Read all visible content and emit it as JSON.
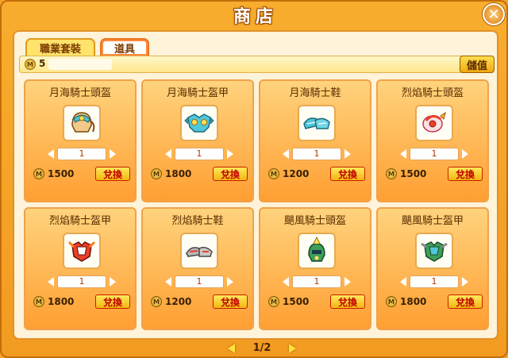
{
  "window": {
    "title": "商店"
  },
  "tabs": [
    {
      "label": "職業套裝"
    },
    {
      "label": "道具"
    }
  ],
  "currency": {
    "amount": "5",
    "deposit_label": "儲值"
  },
  "items": [
    {
      "name": "月海騎士頭盔",
      "qty": "1",
      "price": "1500",
      "buy_label": "兌換",
      "icon": "helmet-icon"
    },
    {
      "name": "月海騎士盔甲",
      "qty": "1",
      "price": "1800",
      "buy_label": "兌換",
      "icon": "armor-icon"
    },
    {
      "name": "月海騎士鞋",
      "qty": "1",
      "price": "1200",
      "buy_label": "兌換",
      "icon": "boots-icon"
    },
    {
      "name": "烈焰騎士頭盔",
      "qty": "1",
      "price": "1500",
      "buy_label": "兌換",
      "icon": "helmet-icon"
    },
    {
      "name": "烈焰騎士盔甲",
      "qty": "1",
      "price": "1800",
      "buy_label": "兌換",
      "icon": "armor-icon"
    },
    {
      "name": "烈焰騎士鞋",
      "qty": "1",
      "price": "1200",
      "buy_label": "兌換",
      "icon": "boots-icon"
    },
    {
      "name": "颶風騎士頭盔",
      "qty": "1",
      "price": "1500",
      "buy_label": "兌換",
      "icon": "helmet-icon"
    },
    {
      "name": "颶風騎士盔甲",
      "qty": "1",
      "price": "1800",
      "buy_label": "兌換",
      "icon": "armor-icon"
    }
  ],
  "pagination": {
    "label": "1/2"
  },
  "colors": {
    "moon": "#4fc6d9",
    "flame": "#e8412a",
    "storm": "#3e9e5a"
  }
}
